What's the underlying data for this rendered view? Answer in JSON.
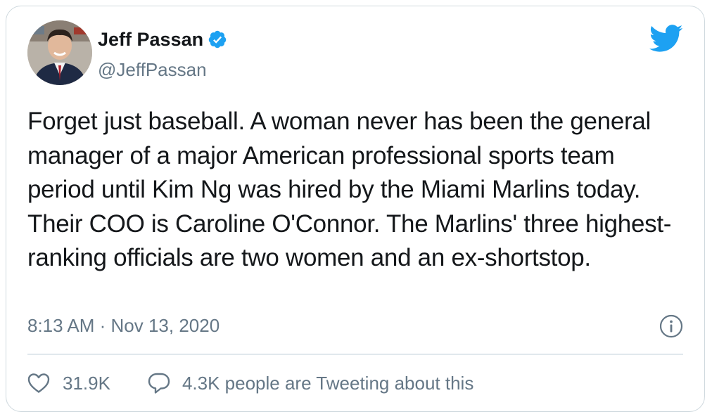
{
  "tweet": {
    "author_name": "Jeff Passan",
    "handle": "@JeffPassan",
    "text": "Forget just baseball. A woman never has been the general manager of a major American professional sports team period until Kim Ng was hired by the Miami Marlins today. Their COO is Caroline O'Connor. The Marlins' three highest-ranking officials are two women and an ex-shortstop.",
    "timestamp": "8:13 AM · Nov 13, 2020",
    "likes": "31.9K",
    "conversation_label": "4.3K people are Tweeting about this"
  },
  "icons": {
    "verified": "verified-badge-icon",
    "brand": "twitter-bird-icon",
    "info": "info-icon",
    "like": "heart-icon",
    "conversation": "speech-bubble-icon"
  },
  "colors": {
    "brand": "#1da1f2",
    "text": "#14171a",
    "secondary": "#657786",
    "border": "#cfd9de"
  }
}
